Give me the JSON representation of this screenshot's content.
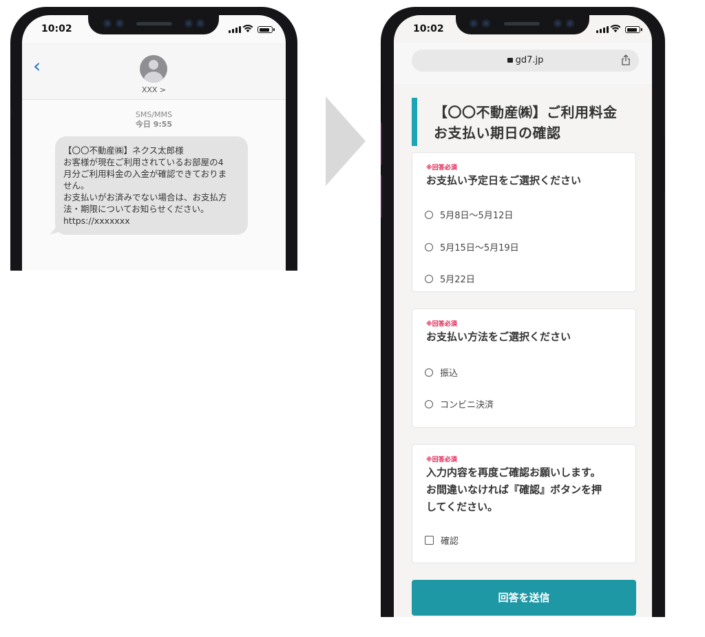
{
  "status": {
    "time": "10:02"
  },
  "sms": {
    "contact_name": "XXX >",
    "service": "SMS/MMS",
    "timestamp": "今日 9:55",
    "message_lines": [
      "【〇〇不動産㈱】ネクス太郎様",
      "お客様が現在ご利用されているお部屋の4",
      "月分ご利用料金の入金が確認できておりま",
      "せん。",
      "お支払いがお済みでない場合は、お支払方",
      "法・期限についてお知らせください。",
      "https://xxxxxxx"
    ]
  },
  "browser": {
    "url": "gd7.jp"
  },
  "form": {
    "title_line1": "【〇〇不動産㈱】ご利用料金",
    "title_line2": "お支払い期日の確認",
    "required_label": "※回答必須",
    "q1": {
      "question": "お支払い予定日をご選択ください",
      "options": [
        "5月8日〜5月12日",
        "5月15日〜5月19日",
        "5月22日"
      ]
    },
    "q2": {
      "question": "お支払い方法をご選択ください",
      "options": [
        "振込",
        "コンビニ決済"
      ]
    },
    "q3": {
      "question_lines": [
        "入力内容を再度ご確認お願いします。",
        "お間違いなければ『確認』ボタンを押",
        "してください。"
      ],
      "checkbox_label": "確認"
    },
    "submit_label": "回答を送信"
  },
  "colors": {
    "accent": "#1ba5b6",
    "submit": "#1f98a6",
    "required": "#e01e4f",
    "link": "#1f6fd1"
  }
}
